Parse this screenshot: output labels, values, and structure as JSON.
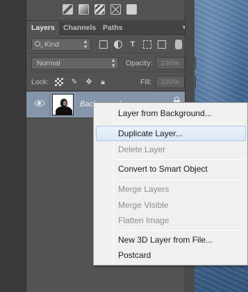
{
  "adjustments": {
    "icons": [
      "brightness-icon",
      "curves-icon",
      "levels-icon",
      "exposure-icon",
      "solid-color-icon"
    ]
  },
  "tabs": [
    {
      "label": "Layers",
      "active": true
    },
    {
      "label": "Channels",
      "active": false
    },
    {
      "label": "Paths",
      "active": false
    }
  ],
  "filter": {
    "kind_label": "Kind",
    "icons": [
      "pixel-filter-icon",
      "adjustment-filter-icon",
      "type-filter-icon",
      "shape-filter-icon",
      "smart-object-filter-icon"
    ]
  },
  "blend": {
    "mode": "Normal",
    "opacity_label": "Opacity:",
    "opacity_value": "100%"
  },
  "lock": {
    "label": "Lock:",
    "fill_label": "Fill:",
    "fill_value": "100%"
  },
  "layer": {
    "name": "Background",
    "visible": true,
    "locked": true
  },
  "context_menu": {
    "items": [
      {
        "label": "Layer from Background...",
        "enabled": true
      },
      {
        "label": "Duplicate Layer...",
        "enabled": true,
        "highlighted": true
      },
      {
        "label": "Delete Layer",
        "enabled": false
      },
      {
        "label": "Convert to Smart Object",
        "enabled": true
      },
      {
        "label": "Merge Layers",
        "enabled": false
      },
      {
        "label": "Merge Visible",
        "enabled": false
      },
      {
        "label": "Flatten Image",
        "enabled": false
      },
      {
        "label": "New 3D Layer from File...",
        "enabled": true
      },
      {
        "label": "Postcard",
        "enabled": true
      }
    ]
  },
  "colors": {
    "panel_bg": "#535353",
    "selected_layer_bg": "#8696aa",
    "menu_bg": "#f0f0f0",
    "menu_highlight_border": "#a8c8ec"
  }
}
